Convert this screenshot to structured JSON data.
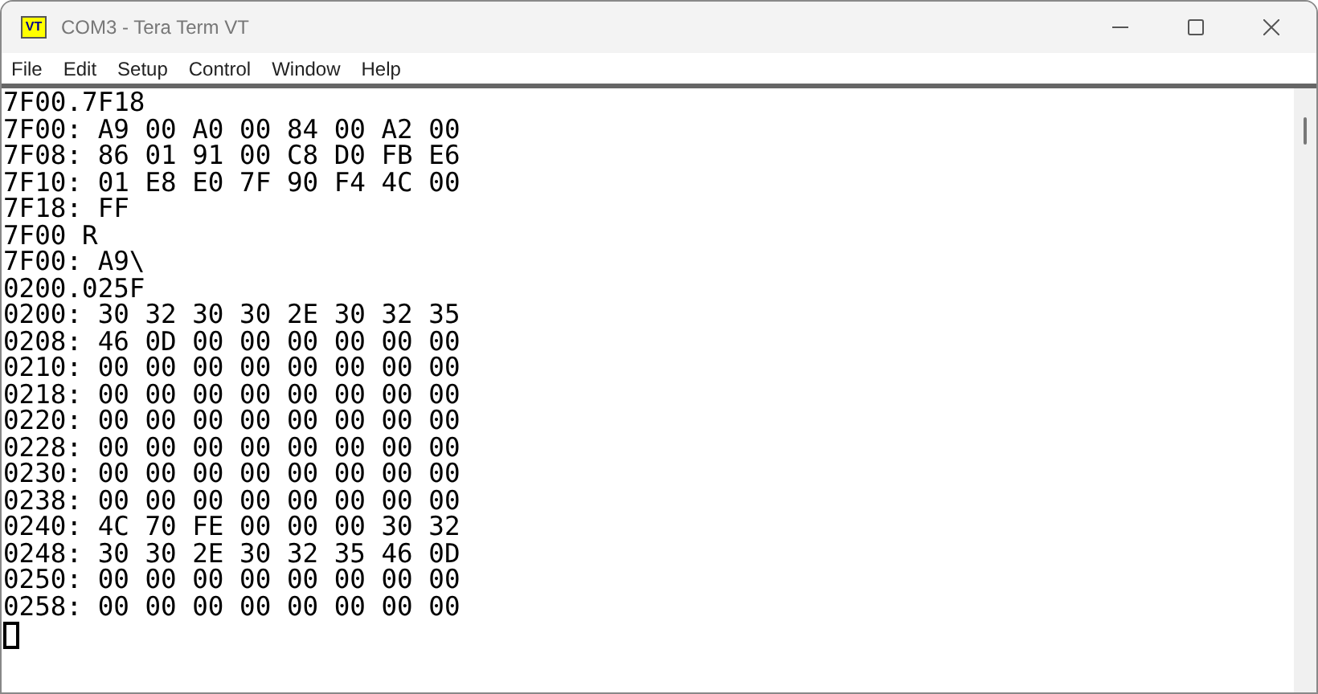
{
  "window": {
    "title": "COM3 - Tera Term VT",
    "app_icon": "VT"
  },
  "menu": [
    "File",
    "Edit",
    "Setup",
    "Control",
    "Window",
    "Help"
  ],
  "terminal": {
    "lines": [
      "7F00.7F18",
      "7F00: A9 00 A0 00 84 00 A2 00",
      "7F08: 86 01 91 00 C8 D0 FB E6",
      "7F10: 01 E8 E0 7F 90 F4 4C 00",
      "7F18: FF",
      "7F00 R",
      "7F00: A9\\",
      "0200.025F",
      "0200: 30 32 30 30 2E 30 32 35",
      "0208: 46 0D 00 00 00 00 00 00",
      "0210: 00 00 00 00 00 00 00 00",
      "0218: 00 00 00 00 00 00 00 00",
      "0220: 00 00 00 00 00 00 00 00",
      "0228: 00 00 00 00 00 00 00 00",
      "0230: 00 00 00 00 00 00 00 00",
      "0238: 00 00 00 00 00 00 00 00",
      "0240: 4C 70 FE 00 00 00 30 32",
      "0248: 30 30 2E 30 32 35 46 0D",
      "0250: 00 00 00 00 00 00 00 00",
      "0258: 00 00 00 00 00 00 00 00"
    ],
    "cursor": true
  }
}
